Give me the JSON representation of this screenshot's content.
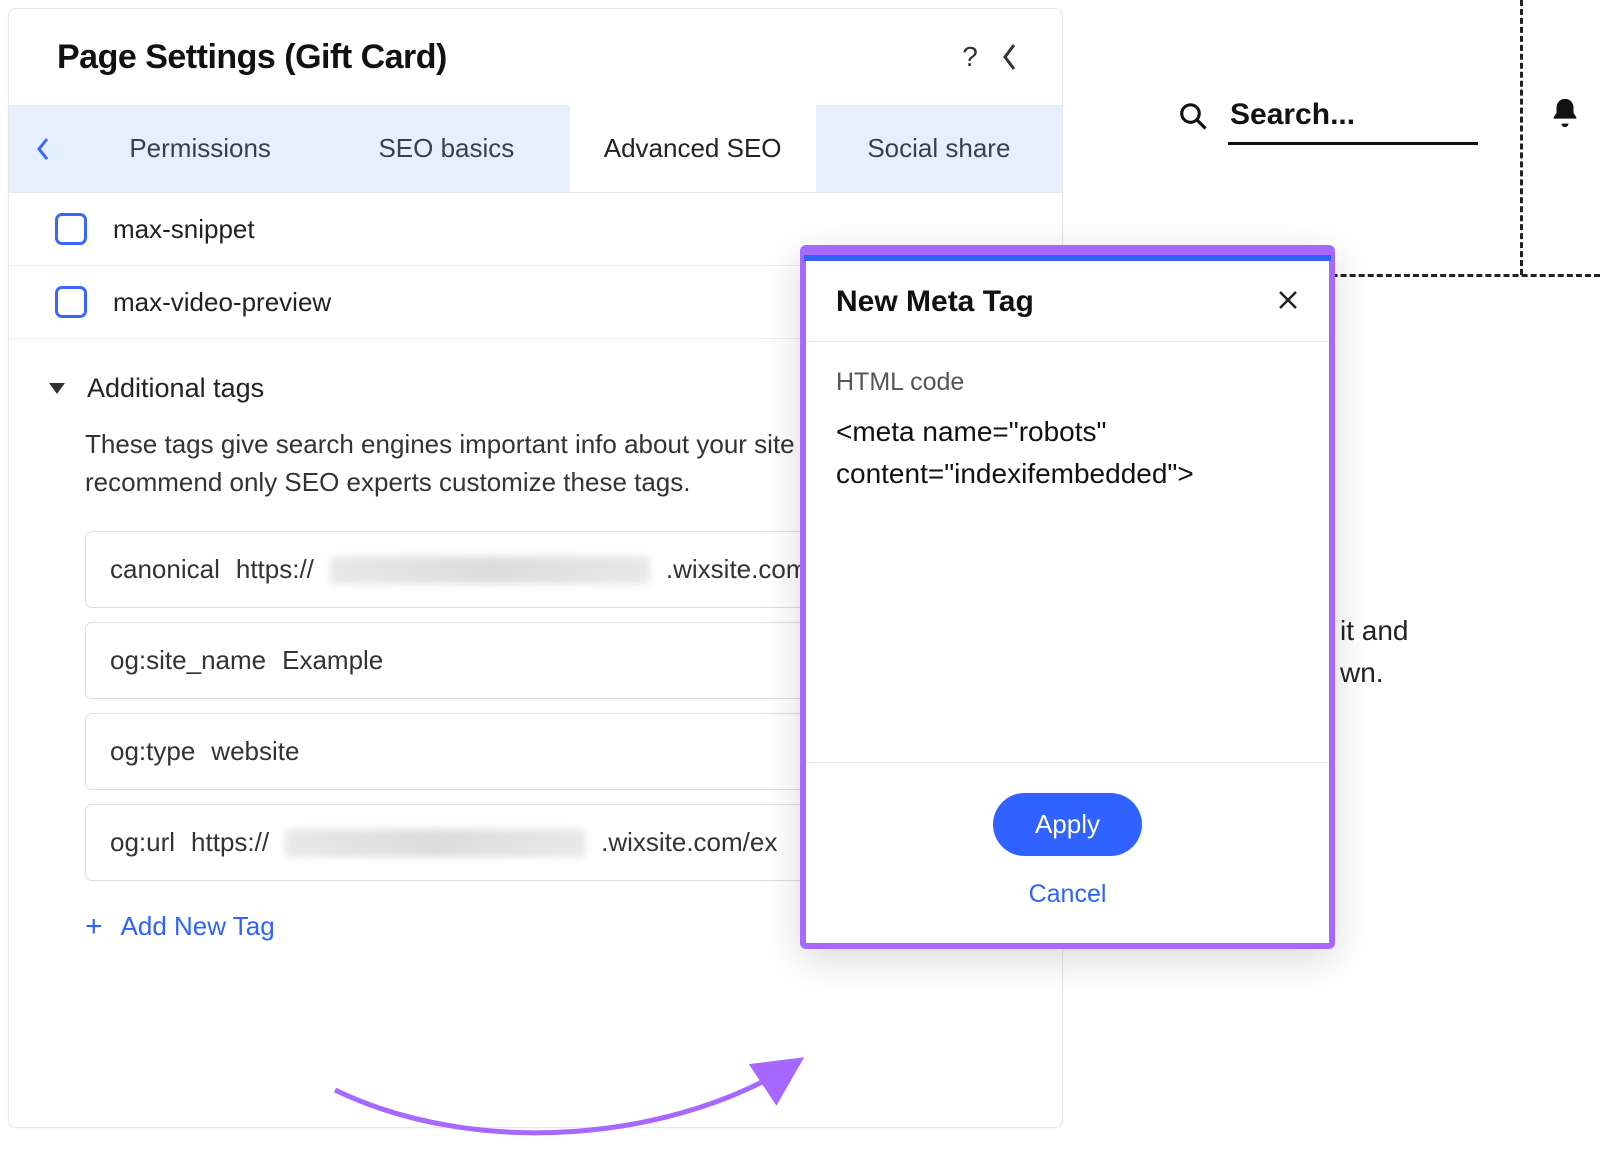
{
  "panel": {
    "title": "Page Settings (Gift Card)"
  },
  "tabs": {
    "items": [
      "Permissions",
      "SEO basics",
      "Advanced SEO",
      "Social share"
    ],
    "activeIndex": 2
  },
  "robots": {
    "options": [
      {
        "label": "max-snippet",
        "checked": false
      },
      {
        "label": "max-video-preview",
        "checked": false
      }
    ]
  },
  "additional": {
    "heading": "Additional tags",
    "description": "These tags give search engines important info about your site pages. We recommend only SEO experts customize these tags.",
    "tags": [
      {
        "key": "canonical",
        "prefix": "https://",
        "suffix": ".wixsite.com/"
      },
      {
        "key": "og:site_name",
        "value": "Example"
      },
      {
        "key": "og:type",
        "value": "website"
      },
      {
        "key": "og:url",
        "prefix": "https://",
        "suffix": ".wixsite.com/ex"
      }
    ],
    "add_label": "Add New Tag"
  },
  "modal": {
    "title": "New Meta Tag",
    "field_label": "HTML code",
    "code": "<meta name=\"robots\" content=\"indexifembedded\">",
    "apply": "Apply",
    "cancel": "Cancel"
  },
  "search": {
    "placeholder": "Search..."
  },
  "background_text": {
    "line1": "it and",
    "line2": "wn."
  }
}
